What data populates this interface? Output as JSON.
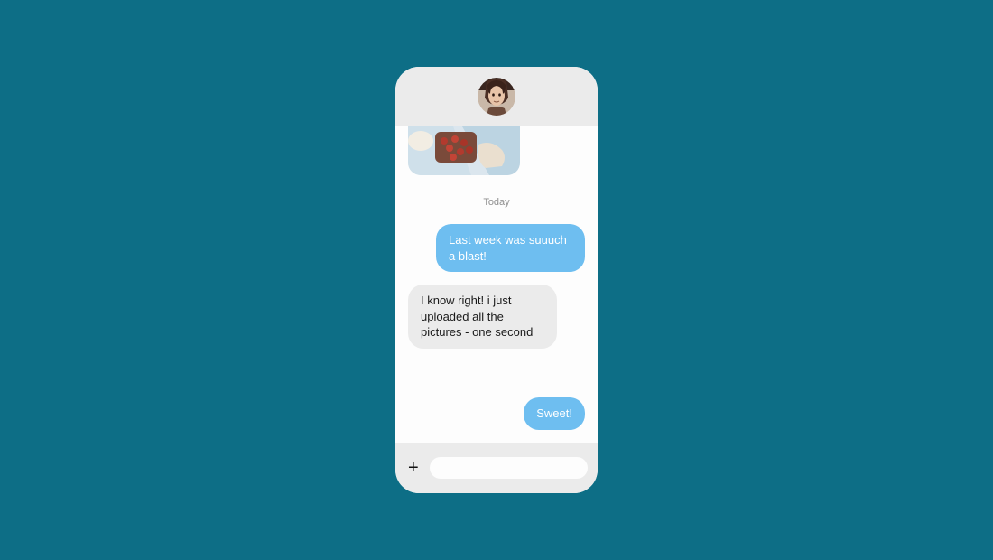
{
  "colors": {
    "page_bg": "#0d6e86",
    "phone_bg": "#fdfdfd",
    "bar_bg": "#ebebeb",
    "outgoing_bubble": "#6ebef0",
    "incoming_bubble": "#ebebeb",
    "date_text": "#8f8f8f"
  },
  "header": {
    "avatar_name": "contact-avatar"
  },
  "conversation": {
    "date_separator": "Today",
    "messages": [
      {
        "type": "image",
        "direction": "in",
        "name": "shared-photo"
      },
      {
        "type": "text",
        "direction": "out",
        "text": "Last week was suuuch a blast!"
      },
      {
        "type": "text",
        "direction": "in",
        "text": "I know right! i just uploaded all the pictures - one second"
      },
      {
        "type": "text",
        "direction": "out",
        "text": "Sweet!"
      }
    ]
  },
  "composer": {
    "add_label": "+",
    "input_placeholder": "",
    "input_value": "",
    "send_icon": "paper-plane-icon"
  }
}
